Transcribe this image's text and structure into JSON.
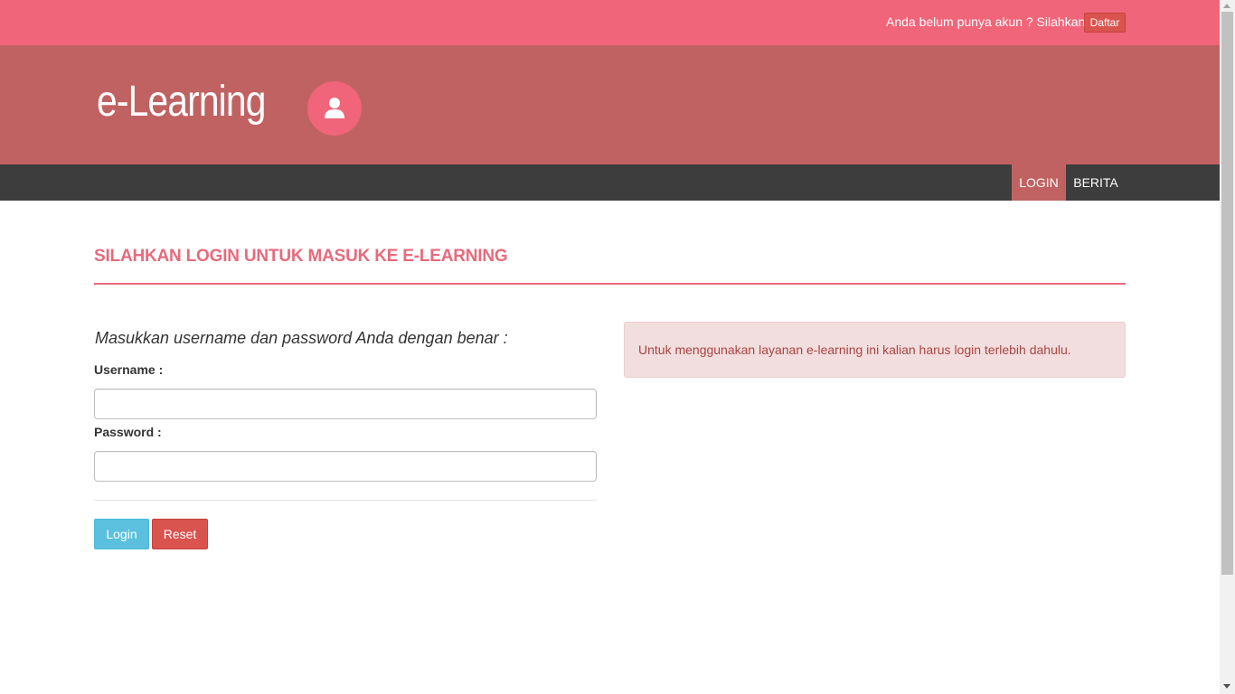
{
  "topbar": {
    "prompt": "Anda belum punya akun ? Silahkan",
    "register_label": "Daftar"
  },
  "header": {
    "brand": "e-Learning",
    "icon": "user-icon"
  },
  "nav": {
    "items": [
      {
        "label": "LOGIN",
        "active": true
      },
      {
        "label": "BERITA",
        "active": false
      }
    ]
  },
  "main": {
    "title": "SILAHKAN LOGIN UNTUK MASUK KE E-LEARNING",
    "form": {
      "lead": "Masukkan username dan password Anda dengan benar :",
      "username_label": "Username :",
      "username_value": "",
      "password_label": "Password :",
      "password_value": "",
      "login_label": "Login",
      "reset_label": "Reset"
    },
    "alert": {
      "text": "Untuk menggunakan layanan e-learning ini kalian harus login terlebih dahulu."
    }
  },
  "colors": {
    "topbar": "#f06579",
    "header": "#c06262",
    "navbar": "#3d3d3d",
    "accent": "#e86a7c",
    "login_button": "#5bc0de",
    "reset_button": "#d9534f",
    "alert_bg": "#f2dede",
    "alert_text": "#a94442"
  }
}
